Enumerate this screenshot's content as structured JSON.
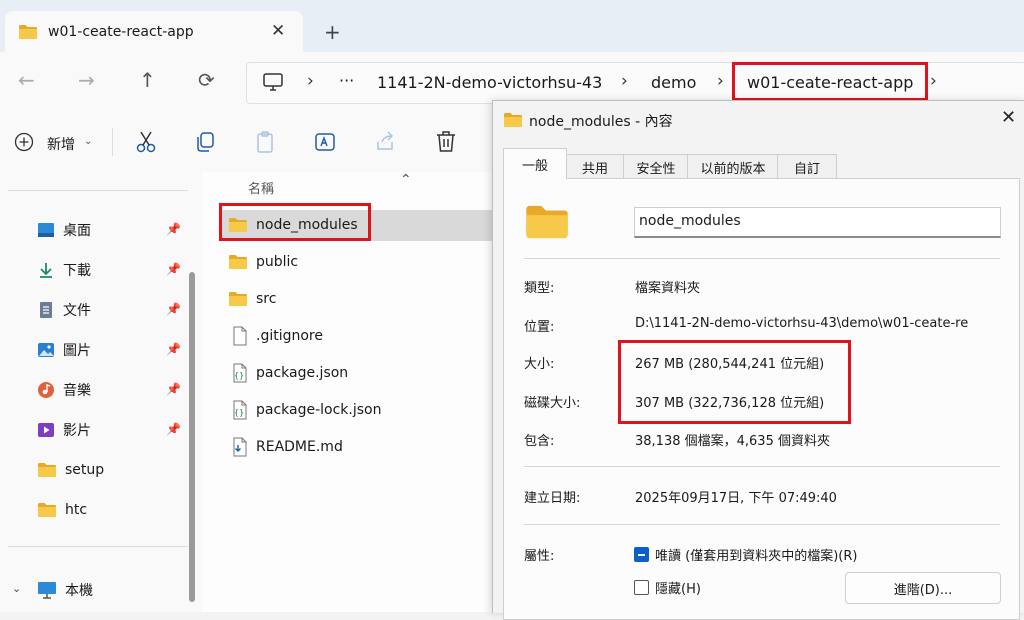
{
  "tab": {
    "title": "w01-ceate-react-app",
    "close": "✕",
    "new_tab": "+"
  },
  "breadcrumb": {
    "more": "···",
    "items": [
      "1141-2N-demo-victorhsu-43",
      "demo",
      "w01-ceate-react-app"
    ],
    "sep": "›"
  },
  "toolbar": {
    "new_label": "新增"
  },
  "sidebar": {
    "items": [
      {
        "label": "桌面",
        "icon": "desktop-icon",
        "pinned": true
      },
      {
        "label": "下載",
        "icon": "download-icon",
        "pinned": true
      },
      {
        "label": "文件",
        "icon": "document-icon",
        "pinned": true
      },
      {
        "label": "圖片",
        "icon": "pictures-icon",
        "pinned": true
      },
      {
        "label": "音樂",
        "icon": "music-icon",
        "pinned": true
      },
      {
        "label": "影片",
        "icon": "videos-icon",
        "pinned": true
      },
      {
        "label": "setup",
        "icon": "folder-icon",
        "pinned": false
      },
      {
        "label": "htc",
        "icon": "folder-icon",
        "pinned": false
      },
      {
        "label": "本機",
        "icon": "this-pc-icon",
        "pinned": false
      }
    ]
  },
  "filelist": {
    "column_name": "名稱",
    "files": [
      {
        "name": "node_modules",
        "type": "folder"
      },
      {
        "name": "public",
        "type": "folder"
      },
      {
        "name": "src",
        "type": "folder"
      },
      {
        "name": ".gitignore",
        "type": "file"
      },
      {
        "name": "package.json",
        "type": "json"
      },
      {
        "name": "package-lock.json",
        "type": "json"
      },
      {
        "name": "README.md",
        "type": "md"
      }
    ]
  },
  "dialog": {
    "title": "node_modules - 內容",
    "tabs": [
      "一般",
      "共用",
      "安全性",
      "以前的版本",
      "自訂"
    ],
    "name": "node_modules",
    "type_label": "類型:",
    "type_value": "檔案資料夾",
    "location_label": "位置:",
    "location_value": "D:\\1141-2N-demo-victorhsu-43\\demo\\w01-ceate-re",
    "size_label": "大小:",
    "size_value": "267 MB (280,544,241 位元組)",
    "disk_label": "磁碟大小:",
    "disk_value": "307 MB (322,736,128 位元組)",
    "contains_label": "包含:",
    "contains_value": "38,138 個檔案，4,635 個資料夾",
    "created_label": "建立日期:",
    "created_value": "2025年09月17日, 下午 07:49:40",
    "attr_label": "屬性:",
    "readonly_label": "唯讀 (僅套用到資料夾中的檔案)(R)",
    "hidden_label": "隱藏(H)",
    "advanced_label": "進階(D)..."
  },
  "colors": {
    "highlight": "#e0121e",
    "folder": "#f2c14e",
    "accent": "#0a5fc9"
  }
}
